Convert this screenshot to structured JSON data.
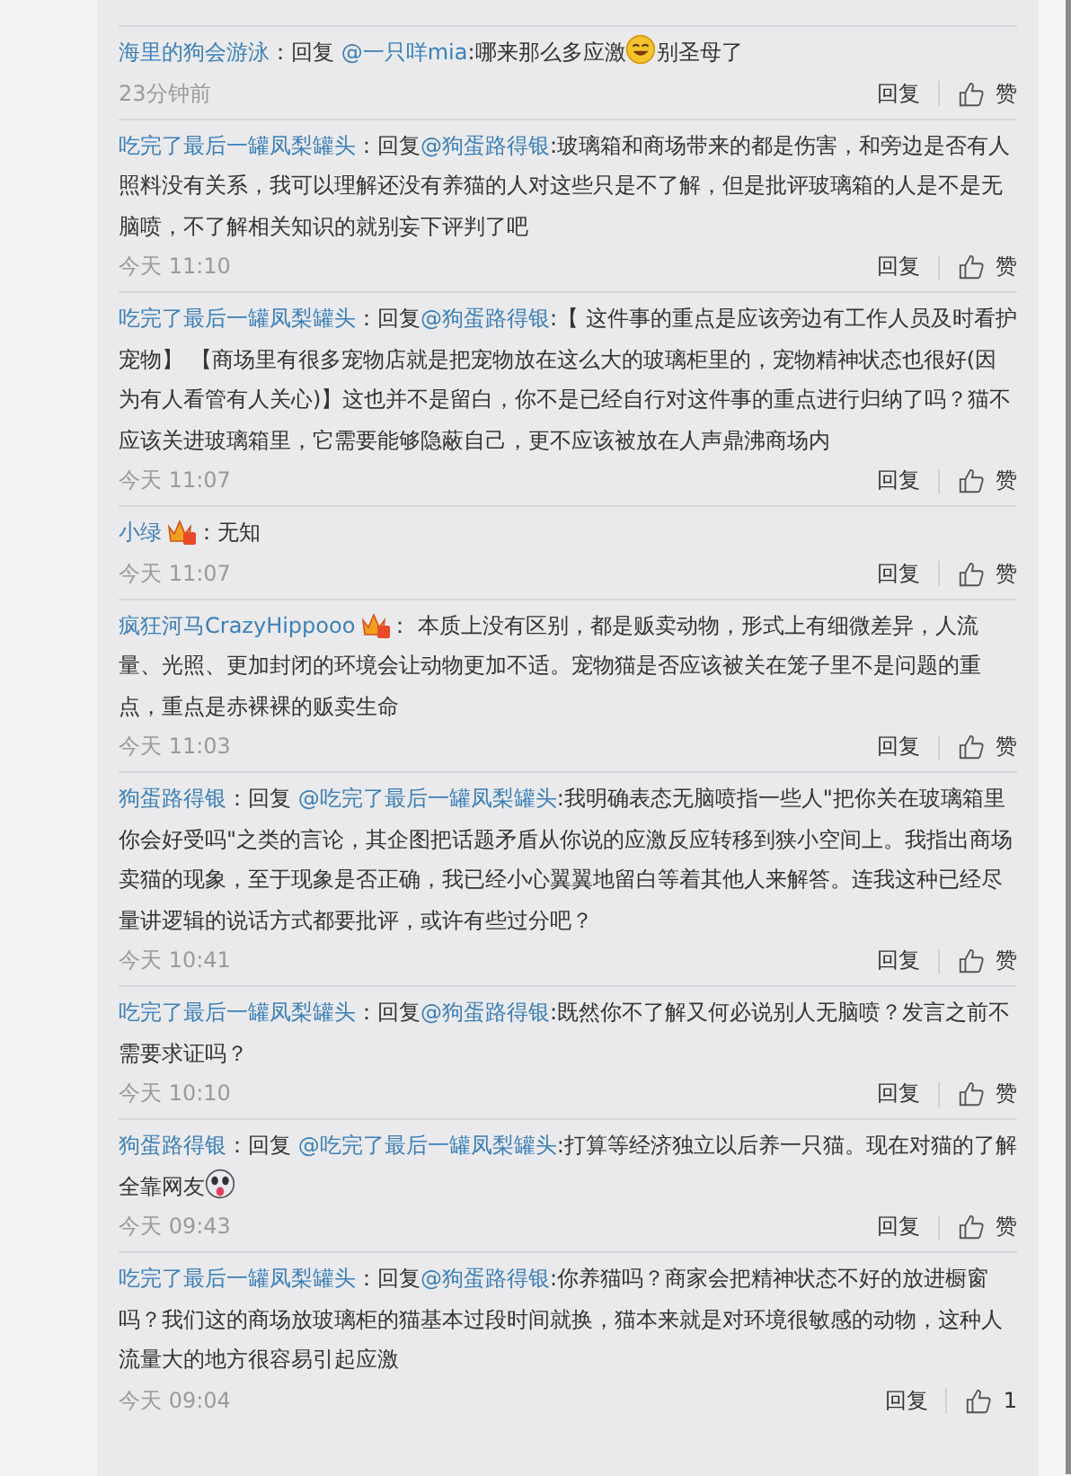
{
  "comments": [
    {
      "author": "海里的狗会游泳",
      "badge": false,
      "prefix": "：回复 ",
      "mention": "@一只咩mia",
      "parts": [
        {
          "kind": "text",
          "text": ":哪来那么多应激"
        },
        {
          "kind": "smile"
        },
        {
          "kind": "text",
          "text": "别圣母了"
        }
      ],
      "time": "23分钟前",
      "reply": "回复",
      "like": "赞"
    },
    {
      "author": "吃完了最后一罐凤梨罐头",
      "badge": false,
      "prefix": "：回复",
      "mention": "@狗蛋路得银",
      "parts": [
        {
          "kind": "text",
          "text": ":玻璃箱和商场带来的都是伤害，和旁边是否有人照料没有关系，我可以理解还没有养猫的人对这些只是不了解，但是批评玻璃箱的人是不是无脑喷，不了解相关知识的就别妄下评判了吧"
        }
      ],
      "time": "今天 11:10",
      "reply": "回复",
      "like": "赞"
    },
    {
      "author": "吃完了最后一罐凤梨罐头",
      "badge": false,
      "prefix": "：回复",
      "mention": "@狗蛋路得银",
      "parts": [
        {
          "kind": "text",
          "text": ":【 这件事的重点是应该旁边有工作人员及时看护宠物】 【商场里有很多宠物店就是把宠物放在这么大的玻璃柜里的，宠物精神状态也很好(因为有人看管有人关心)】这也并不是留白，你不是已经自行对这件事的重点进行归纳了吗？猫不应该关进玻璃箱里，它需要能够隐蔽自己，更不应该被放在人声鼎沸商场内"
        }
      ],
      "time": "今天 11:07",
      "reply": "回复",
      "like": "赞"
    },
    {
      "author": "小绿",
      "badge": true,
      "prefix": "：",
      "parts": [
        {
          "kind": "text",
          "text": "无知"
        }
      ],
      "time": "今天 11:07",
      "reply": "回复",
      "like": "赞"
    },
    {
      "author": "疯狂河马CrazyHippooo",
      "badge": true,
      "prefix": "： ",
      "parts": [
        {
          "kind": "text",
          "text": "本质上没有区别，都是贩卖动物，形式上有细微差异，人流量、光照、更加封闭的环境会让动物更加不适。宠物猫是否应该被关在笼子里不是问题的重点，重点是赤裸裸的贩卖生命"
        }
      ],
      "time": "今天 11:03",
      "reply": "回复",
      "like": "赞"
    },
    {
      "author": "狗蛋路得银",
      "badge": false,
      "prefix": "：回复 ",
      "mention": "@吃完了最后一罐凤梨罐头",
      "parts": [
        {
          "kind": "text",
          "text": ":我明确表态无脑喷指一些人\"把你关在玻璃箱里你会好受吗\"之类的言论，其企图把话题矛盾从你说的应激反应转移到狭小空间上。我指出商场卖猫的现象，至于现象是否正确，我已经小心翼翼地留白等着其他人来解答。连我这种已经尽量讲逻辑的说话方式都要批评，或许有些过分吧？"
        }
      ],
      "time": "今天 10:41",
      "reply": "回复",
      "like": "赞"
    },
    {
      "author": "吃完了最后一罐凤梨罐头",
      "badge": false,
      "prefix": "：回复",
      "mention": "@狗蛋路得银",
      "parts": [
        {
          "kind": "text",
          "text": ":既然你不了解又何必说别人无脑喷？发言之前不需要求证吗？"
        }
      ],
      "time": "今天 10:10",
      "reply": "回复",
      "like": "赞"
    },
    {
      "author": "狗蛋路得银",
      "badge": false,
      "prefix": "：回复 ",
      "mention": "@吃完了最后一罐凤梨罐头",
      "parts": [
        {
          "kind": "text",
          "text": ":打算等经济独立以后养一只猫。现在对猫的了解全靠网友"
        },
        {
          "kind": "dog"
        }
      ],
      "time": "今天 09:43",
      "reply": "回复",
      "like": "赞"
    },
    {
      "author": "吃完了最后一罐凤梨罐头",
      "badge": false,
      "prefix": "：回复",
      "mention": "@狗蛋路得银",
      "parts": [
        {
          "kind": "text",
          "text": ":你养猫吗？商家会把精神状态不好的放进橱窗吗？我们这的商场放玻璃柜的猫基本过段时间就换，猫本来就是对环境很敏感的动物，这种人流量大的地方很容易引起应激"
        }
      ],
      "time": "今天 09:04",
      "reply": "回复",
      "like": "1"
    }
  ]
}
